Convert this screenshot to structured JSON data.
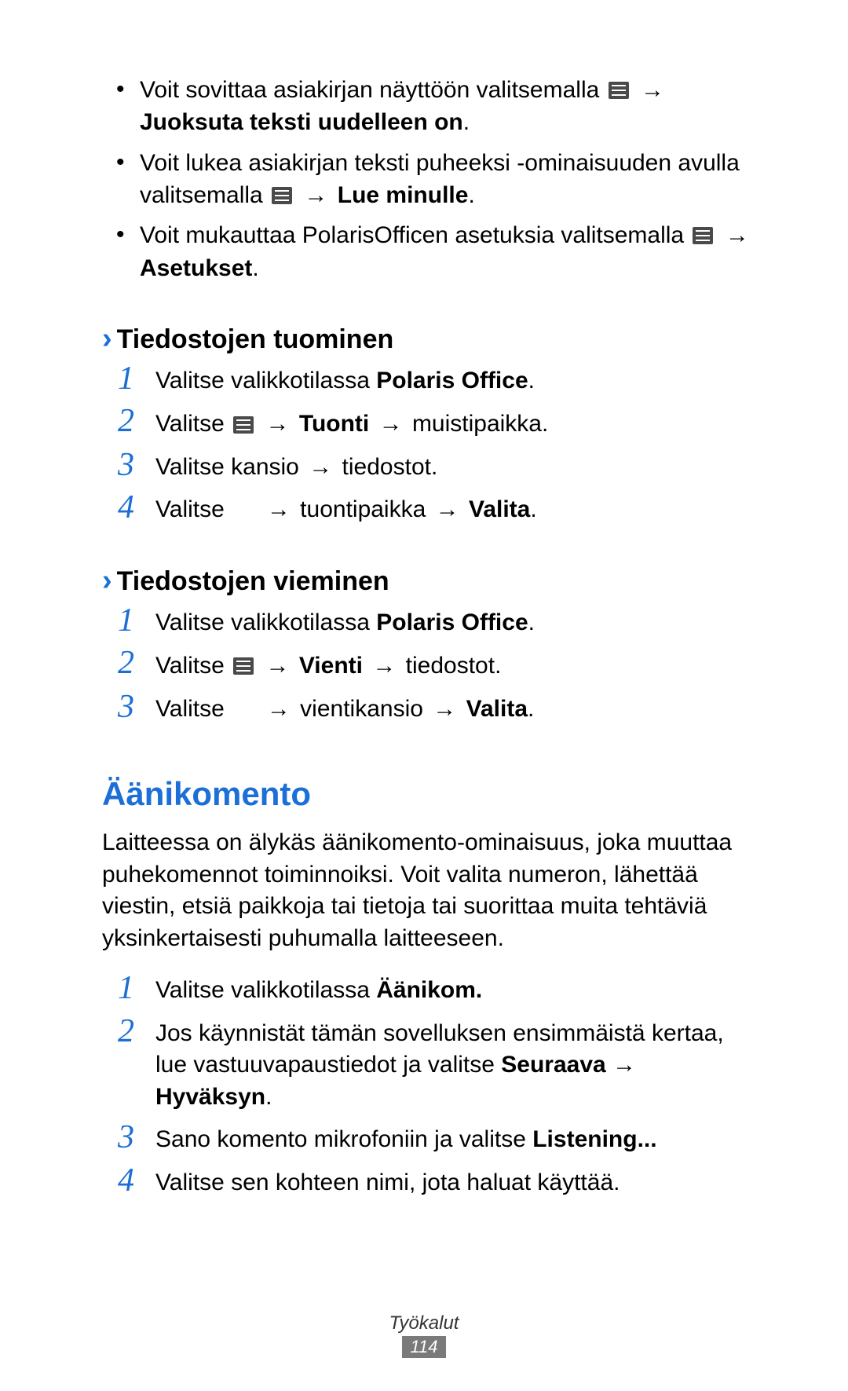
{
  "bullets": [
    {
      "pre": "Voit sovittaa asiakirjan näyttöön valitsemalla ",
      "after_icon": " ",
      "arrow": "→",
      "tail_bold": "Juoksuta teksti uudelleen on",
      "tail_plain": "."
    },
    {
      "pre": "Voit lukea asiakirjan teksti puheeksi -ominaisuuden avulla valitsemalla ",
      "after_icon": " ",
      "arrow": "→",
      "tail_bold": " Lue minulle",
      "tail_plain": "."
    },
    {
      "pre": "Voit mukauttaa PolarisOfficen asetuksia valitsemalla ",
      "after_icon": " ",
      "arrow": "→",
      "tail_bold": "Asetukset",
      "tail_plain": "."
    }
  ],
  "section_import": {
    "chevron": "›",
    "title": "Tiedostojen tuominen",
    "steps": {
      "s1": {
        "num": "1",
        "pre": "Valitse valikkotilassa ",
        "bold": "Polaris Office",
        "post": "."
      },
      "s2": {
        "num": "2",
        "pre": "Valitse ",
        "arrow1": "→",
        "bold1": "Tuonti",
        "arrow2": "→",
        "post": " muistipaikka."
      },
      "s3": {
        "num": "3",
        "pre": "Valitse kansio ",
        "arrow": "→",
        "post": " tiedostot."
      },
      "s4": {
        "num": "4",
        "pre": "Valitse ",
        "arrow1": "→",
        "mid": " tuontipaikka ",
        "arrow2": "→",
        "bold": " Valita",
        "post": "."
      }
    }
  },
  "section_export": {
    "chevron": "›",
    "title": "Tiedostojen vieminen",
    "steps": {
      "s1": {
        "num": "1",
        "pre": "Valitse valikkotilassa ",
        "bold": "Polaris Office",
        "post": "."
      },
      "s2": {
        "num": "2",
        "pre": "Valitse ",
        "arrow1": "→",
        "bold1": "Vienti",
        "arrow2": "→",
        "post": " tiedostot."
      },
      "s3": {
        "num": "3",
        "pre": "Valitse ",
        "arrow1": "→",
        "mid": " vientikansio ",
        "arrow2": "→",
        "bold": " Valita",
        "post": "."
      }
    }
  },
  "voice": {
    "heading": "Äänikomento",
    "para": "Laitteessa on älykäs äänikomento-ominaisuus, joka muuttaa puhekomennot toiminnoiksi. Voit valita numeron, lähettää viestin, etsiä paikkoja tai tietoja tai suorittaa muita tehtäviä yksinkertaisesti puhumalla laitteeseen.",
    "steps": {
      "s1": {
        "num": "1",
        "pre": "Valitse valikkotilassa ",
        "bold": "Äänikom."
      },
      "s2": {
        "num": "2",
        "pre": "Jos käynnistät tämän sovelluksen ensimmäistä kertaa, lue vastuuvapaustiedot ja valitse ",
        "bold1": "Seuraava",
        "arrow": " → ",
        "bold2": "Hyväksyn",
        "post": "."
      },
      "s3": {
        "num": "3",
        "pre": "Sano komento mikrofoniin ja valitse ",
        "bold": "Listening..."
      },
      "s4": {
        "num": "4",
        "text": "Valitse sen kohteen nimi, jota haluat käyttää."
      }
    }
  },
  "footer": {
    "label": "Työkalut",
    "page": "114"
  }
}
